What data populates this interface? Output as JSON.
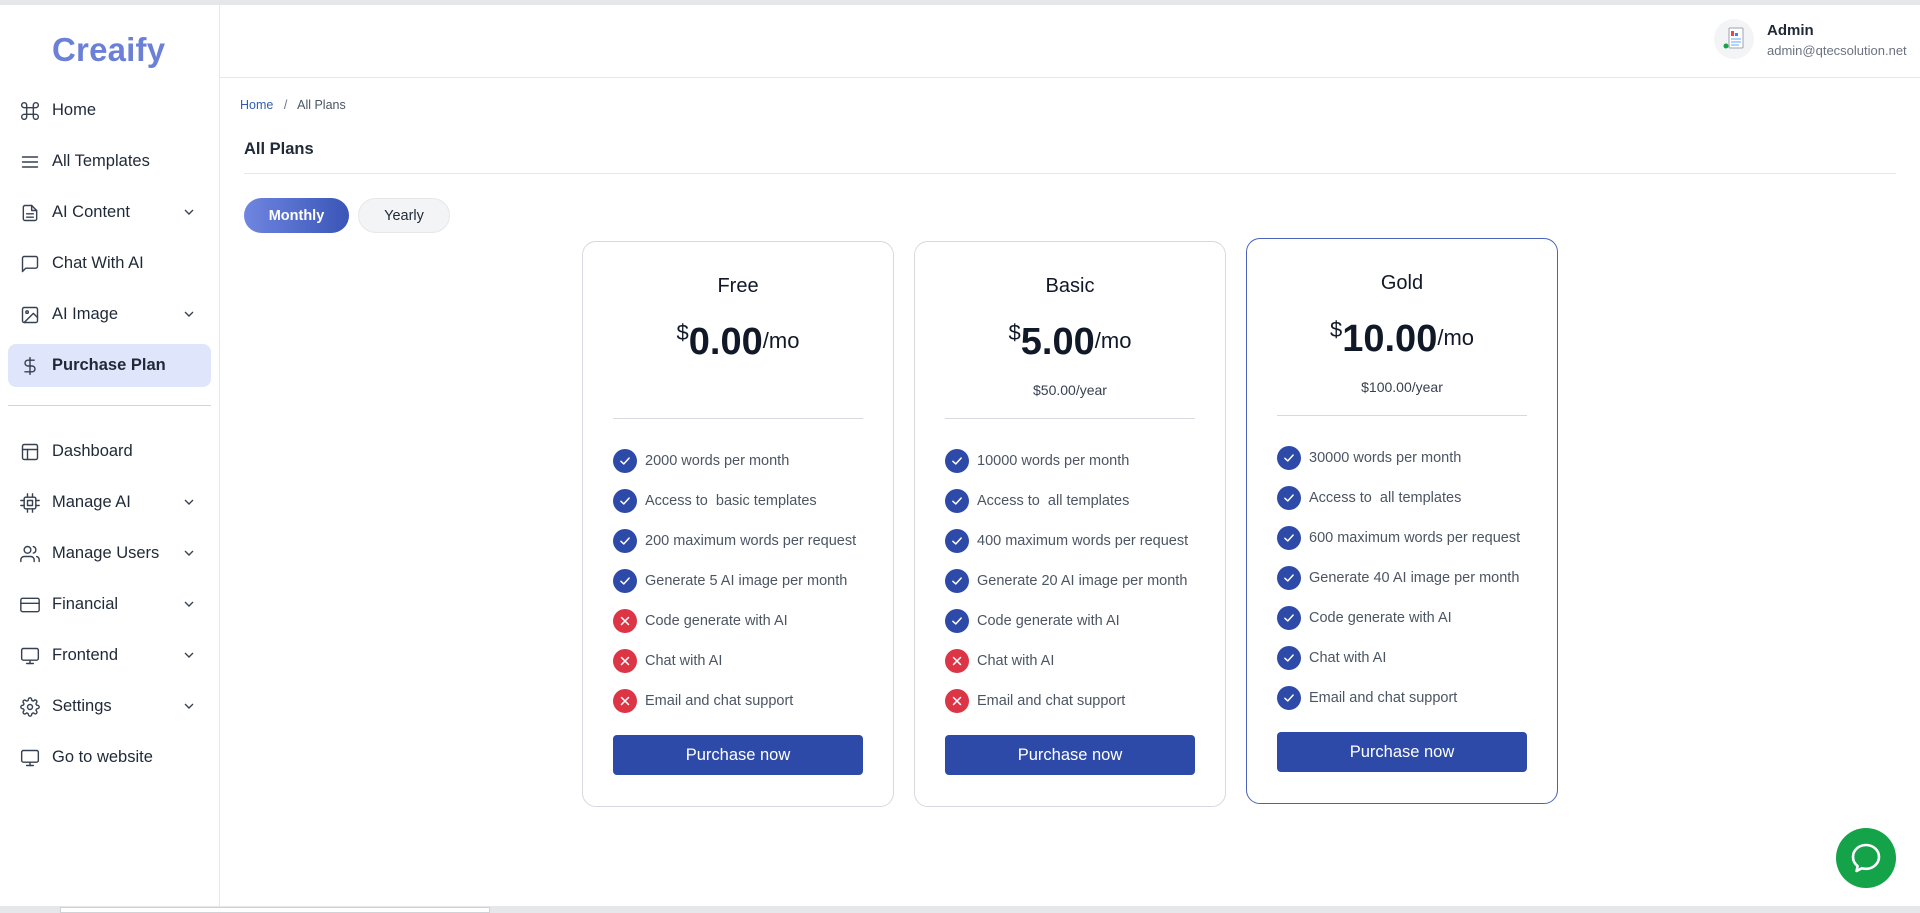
{
  "app": {
    "logo": "Creaify"
  },
  "sidebar": {
    "items_top": [
      {
        "label": "Home",
        "icon": "command-icon",
        "chevron": false,
        "active": false
      },
      {
        "label": "All Templates",
        "icon": "menu-lines-icon",
        "chevron": false,
        "active": false
      },
      {
        "label": "AI Content",
        "icon": "document-icon",
        "chevron": true,
        "active": false
      },
      {
        "label": "Chat With AI",
        "icon": "chat-bubble-icon",
        "chevron": false,
        "active": false
      },
      {
        "label": "AI Image",
        "icon": "image-icon",
        "chevron": true,
        "active": false
      },
      {
        "label": "Purchase Plan",
        "icon": "dollar-icon",
        "chevron": false,
        "active": true
      }
    ],
    "items_bottom": [
      {
        "label": "Dashboard",
        "icon": "layout-icon",
        "chevron": false
      },
      {
        "label": "Manage AI",
        "icon": "cpu-icon",
        "chevron": true
      },
      {
        "label": "Manage Users",
        "icon": "users-icon",
        "chevron": true
      },
      {
        "label": "Financial",
        "icon": "credit-card-icon",
        "chevron": true
      },
      {
        "label": "Frontend",
        "icon": "monitor-icon",
        "chevron": true
      },
      {
        "label": "Settings",
        "icon": "gear-icon",
        "chevron": true
      },
      {
        "label": "Go to website",
        "icon": "monitor-icon",
        "chevron": false
      }
    ]
  },
  "header": {
    "user_name": "Admin",
    "user_email": "admin@qtecsolution.net"
  },
  "breadcrumb": {
    "home": "Home",
    "separator": "/",
    "current": "All Plans"
  },
  "page": {
    "title": "All Plans"
  },
  "billing_toggle": {
    "monthly": "Monthly",
    "yearly": "Yearly",
    "selected": "Monthly"
  },
  "plans": [
    {
      "name": "Free",
      "currency": "$",
      "amount": "0.00",
      "period": "/mo",
      "yearly": "",
      "features": [
        {
          "text": "2000 words per month",
          "included": true
        },
        {
          "text": "Access to  basic templates",
          "included": true
        },
        {
          "text": "200 maximum words per request",
          "included": true
        },
        {
          "text": "Generate 5 AI image per month",
          "included": true
        },
        {
          "text": "Code generate with AI",
          "included": false
        },
        {
          "text": "Chat with AI",
          "included": false
        },
        {
          "text": "Email and chat support",
          "included": false
        }
      ],
      "button": "Purchase now"
    },
    {
      "name": "Basic",
      "currency": "$",
      "amount": "5.00",
      "period": "/mo",
      "yearly": "$50.00/year",
      "features": [
        {
          "text": "10000 words per month",
          "included": true
        },
        {
          "text": "Access to  all templates",
          "included": true
        },
        {
          "text": "400 maximum words per request",
          "included": true
        },
        {
          "text": "Generate 20 AI image per month",
          "included": true
        },
        {
          "text": "Code generate with AI",
          "included": true
        },
        {
          "text": "Chat with AI",
          "included": false
        },
        {
          "text": "Email and chat support",
          "included": false
        }
      ],
      "button": "Purchase now"
    },
    {
      "name": "Gold",
      "currency": "$",
      "amount": "10.00",
      "period": "/mo",
      "yearly": "$100.00/year",
      "features": [
        {
          "text": "30000 words per month",
          "included": true
        },
        {
          "text": "Access to  all templates",
          "included": true
        },
        {
          "text": "600 maximum words per request",
          "included": true
        },
        {
          "text": "Generate 40 AI image per month",
          "included": true
        },
        {
          "text": "Code generate with AI",
          "included": true
        },
        {
          "text": "Chat with AI",
          "included": true
        },
        {
          "text": "Email and chat support",
          "included": true
        }
      ],
      "button": "Purchase now"
    }
  ],
  "colors": {
    "brand": "#6b80d6",
    "primary": "#2d4aa8",
    "danger": "#dc3545",
    "chat": "#15a34a",
    "active_nav": "#dfe6fb"
  }
}
